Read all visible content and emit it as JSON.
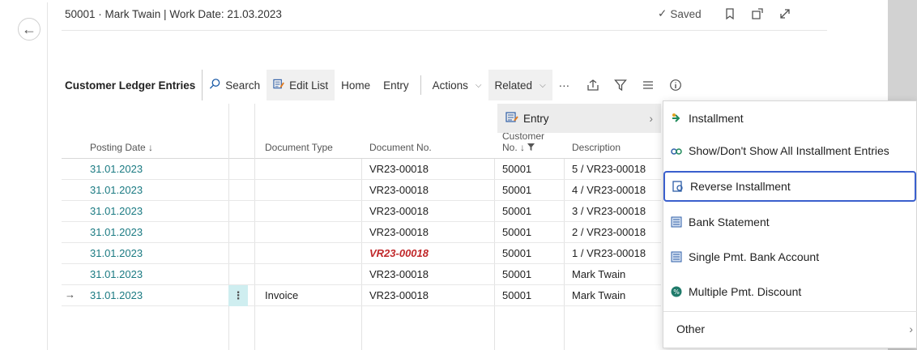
{
  "header": {
    "title": "50001 · Mark Twain | Work Date: 21.03.2023",
    "saved": "Saved"
  },
  "action_bar": {
    "title": "Customer Ledger Entries",
    "search": "Search",
    "edit_list": "Edit List",
    "home": "Home",
    "entry": "Entry",
    "actions": "Actions",
    "related": "Related",
    "more": "···"
  },
  "columns": {
    "posting_date": "Posting Date ↓",
    "document_type": "Document Type",
    "document_no": "Document No.",
    "customer_no_1": "Customer",
    "customer_no_2": "No. ↓",
    "description": "Description"
  },
  "rows": [
    {
      "posting_date": "31.01.2023",
      "document_type": "",
      "document_no": "VR23-00018",
      "customer_no": "50001",
      "description": "5 / VR23-00018"
    },
    {
      "posting_date": "31.01.2023",
      "document_type": "",
      "document_no": "VR23-00018",
      "customer_no": "50001",
      "description": "4 / VR23-00018"
    },
    {
      "posting_date": "31.01.2023",
      "document_type": "",
      "document_no": "VR23-00018",
      "customer_no": "50001",
      "description": "3 / VR23-00018"
    },
    {
      "posting_date": "31.01.2023",
      "document_type": "",
      "document_no": "VR23-00018",
      "customer_no": "50001",
      "description": "2 / VR23-00018"
    },
    {
      "posting_date": "31.01.2023",
      "document_type": "",
      "document_no": "VR23-00018",
      "customer_no": "50001",
      "description": "1 / VR23-00018"
    },
    {
      "posting_date": "31.01.2023",
      "document_type": "",
      "document_no": "VR23-00018",
      "customer_no": "50001",
      "description": "Mark Twain"
    },
    {
      "posting_date": "31.01.2023",
      "document_type": "Invoice",
      "document_no": "VR23-00018",
      "customer_no": "50001",
      "description": "Mark Twain"
    }
  ],
  "submenu": {
    "entry": "Entry"
  },
  "menu": {
    "items": [
      {
        "label": "Installment",
        "icon": "installment-icon"
      },
      {
        "label": "Show/Don't Show All Installment Entries",
        "icon": "toggle-installment-icon"
      },
      {
        "label": "Reverse Installment",
        "icon": "reverse-icon"
      },
      {
        "label": "Bank Statement",
        "icon": "bank-statement-icon"
      },
      {
        "label": "Single Pmt. Bank Account",
        "icon": "bank-account-icon"
      },
      {
        "label": "Multiple Pmt. Discount",
        "icon": "discount-icon"
      },
      {
        "label": "Other",
        "icon": ""
      }
    ]
  },
  "colors": {
    "accent": "#3a5fcd",
    "date_link": "#1a7a82",
    "error": "#c0282a"
  }
}
